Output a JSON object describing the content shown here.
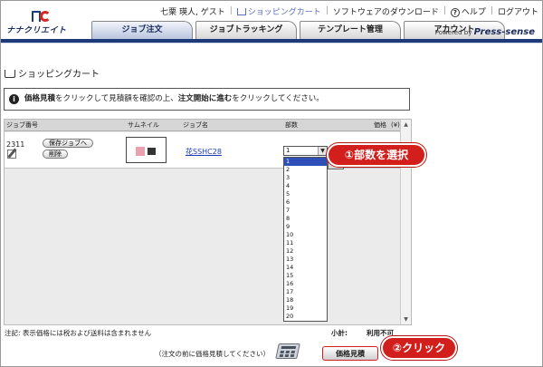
{
  "header": {
    "logo_text": "ナナクリエイト",
    "user": "七栗 瑛人, ゲスト",
    "cart_link": "ショッピングカート",
    "download_link": "ソフトウェアのダウンロード",
    "help_link": "ヘルプ",
    "logout_link": "ログアウト",
    "powered_by": "Powered by",
    "powered_brand": "Press-sense",
    "tabs": [
      "ジョブ注文",
      "ジョブトラッキング",
      "テンプレート管理",
      "アカウント"
    ]
  },
  "page": {
    "title": "ショッピングカート",
    "info_pre": "価格見積",
    "info_mid": "をクリックして見積額を確認の上、",
    "info_bold": "注文開始に進む",
    "info_post": "をクリックしてください。"
  },
  "table": {
    "headers": [
      "ジョブ番号",
      "サムネイル",
      "ジョブ名",
      "部数",
      "価格"
    ],
    "price_unit": "(¥)",
    "row": {
      "job_no": "2311",
      "save_label": "保存ジョブへ",
      "delete_label": "削除",
      "job_name": "花SSHC28",
      "qty_selected": "1"
    }
  },
  "dropdown": {
    "options": [
      "1",
      "2",
      "3",
      "4",
      "5",
      "6",
      "7",
      "8",
      "9",
      "10",
      "11",
      "12",
      "13",
      "14",
      "15",
      "16",
      "17",
      "18",
      "19",
      "20"
    ]
  },
  "callouts": {
    "step1": "①部数を選択",
    "step2": "②クリック"
  },
  "footer": {
    "note": "注記: 表示価格には税および送料は含まれません",
    "subtotal_label": "小計:",
    "subtotal_value": "利用不可",
    "hint": "（注文の前に価格見積してください）",
    "quote_button": "価格見積"
  },
  "colors": {
    "accent": "#1d3a7a",
    "callout": "#d21f1c",
    "selected": "#2f4fb8",
    "link": "#1d3ab8"
  },
  "icons": [
    "cart-icon",
    "help-icon",
    "info-icon",
    "edit-icon",
    "calculator-icon",
    "chevron-down-icon"
  ]
}
